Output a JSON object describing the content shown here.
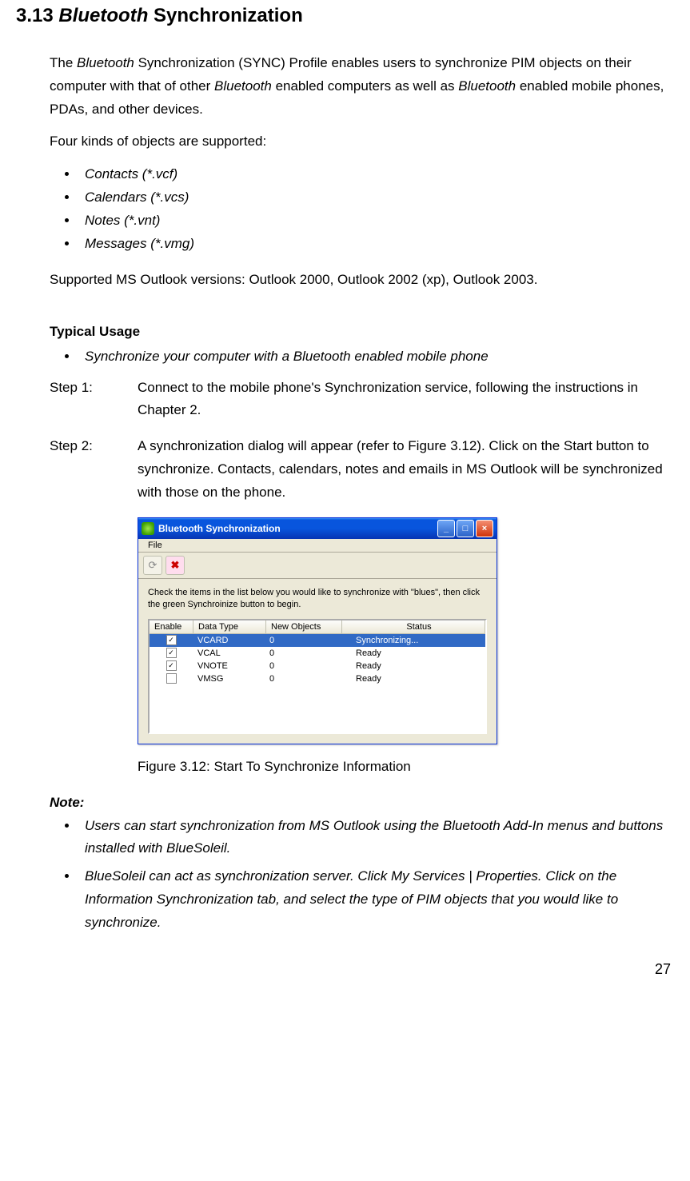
{
  "heading_number": "3.13",
  "heading_italic": "Bluetooth",
  "heading_rest": " Synchronization",
  "intro_p1_a": "The ",
  "intro_p1_b": "Bluetooth",
  "intro_p1_c": " Synchronization (SYNC) Profile enables users to synchronize PIM objects on their computer with that of other ",
  "intro_p1_d": "Bluetooth",
  "intro_p1_e": " enabled computers as well as ",
  "intro_p1_f": "Bluetooth",
  "intro_p1_g": " enabled mobile phones, PDAs, and other devices.",
  "objects_intro": "Four kinds of objects are supported:",
  "objects": [
    "Contacts (*.vcf)",
    "Calendars (*.vcs)",
    "Notes (*.vnt)",
    "Messages (*.vmg)"
  ],
  "versions": "Supported MS Outlook versions: Outlook 2000, Outlook 2002 (xp), Outlook 2003.",
  "typical_usage": "Typical Usage",
  "usage_item": "Synchronize your computer with a Bluetooth enabled mobile phone",
  "step1_label": "Step 1:",
  "step1_body": "Connect to the mobile phone's Synchronization service, following the instructions in Chapter 2.",
  "step2_label": "Step 2:",
  "step2_body": "A synchronization dialog will appear (refer to Figure 3.12). Click on the Start button to synchronize. Contacts, calendars, notes and emails in MS Outlook will be synchronized with those on the phone.",
  "figure_caption": "Figure 3.12: Start To Synchronize Information",
  "note_head": "Note:",
  "notes": [
    "Users can start synchronization from MS Outlook using the Bluetooth Add-In menus and buttons installed with BlueSoleil.",
    "BlueSoleil can act as synchronization server. Click My Services | Properties. Click on the Information Synchronization tab, and select the type of PIM objects that you would like to synchronize."
  ],
  "page_number": "27",
  "dialog": {
    "title": "Bluetooth Synchronization",
    "file_menu": "File",
    "instruction": "Check the items in the list below you would like to synchronize with \"blues\", then click the green Synchroinize button to begin.",
    "columns": {
      "enable": "Enable",
      "datatype": "Data Type",
      "newobjects": "New Objects",
      "status": "Status"
    },
    "rows": [
      {
        "checked": true,
        "datatype": "VCARD",
        "newobjects": "0",
        "status": "Synchronizing...",
        "selected": true
      },
      {
        "checked": true,
        "datatype": "VCAL",
        "newobjects": "0",
        "status": "Ready",
        "selected": false
      },
      {
        "checked": true,
        "datatype": "VNOTE",
        "newobjects": "0",
        "status": "Ready",
        "selected": false
      },
      {
        "checked": false,
        "datatype": "VMSG",
        "newobjects": "0",
        "status": "Ready",
        "selected": false
      }
    ]
  }
}
